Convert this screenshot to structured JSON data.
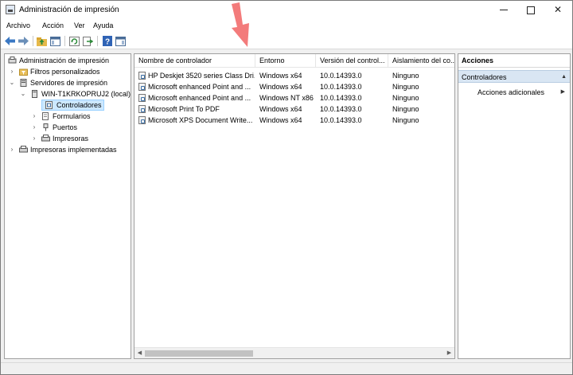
{
  "window": {
    "title": "Administración de impresión"
  },
  "menu": [
    "Archivo",
    "Acción",
    "Ver",
    "Ayuda"
  ],
  "toolbar": {
    "icons": [
      "back-icon",
      "forward-icon",
      "up-folder-icon",
      "show-hide-tree-icon",
      "refresh-icon",
      "export-list-icon",
      "help-icon",
      "show-hide-action-pane-icon"
    ]
  },
  "tree": {
    "root": "Administración de impresión",
    "custom_filters": "Filtros personalizados",
    "print_servers": "Servidores de impresión",
    "server": "WIN-T1KRKOPRUJ2 (local)",
    "drivers": "Controladores",
    "forms": "Formularios",
    "ports": "Puertos",
    "printers": "Impresoras",
    "deployed_printers": "Impresoras implementadas"
  },
  "table": {
    "columns": [
      "Nombre de controlador",
      "Entorno",
      "Versión del control...",
      "Aislamiento del co..."
    ],
    "rows": [
      [
        "HP Deskjet 3520 series Class Dri...",
        "Windows x64",
        "10.0.14393.0",
        "Ninguno"
      ],
      [
        "Microsoft enhanced Point and ...",
        "Windows x64",
        "10.0.14393.0",
        "Ninguno"
      ],
      [
        "Microsoft enhanced Point and ...",
        "Windows NT x86",
        "10.0.14393.0",
        "Ninguno"
      ],
      [
        "Microsoft Print To PDF",
        "Windows x64",
        "10.0.14393.0",
        "Ninguno"
      ],
      [
        "Microsoft XPS Document Write...",
        "Windows x64",
        "10.0.14393.0",
        "Ninguno"
      ]
    ]
  },
  "actions": {
    "header": "Acciones",
    "section": "Controladores",
    "more": "Acciones adicionales"
  },
  "colors": {
    "accent_arrow": "#f26d6d",
    "selection": "#cce8ff",
    "action_section": "#d9e6f3"
  }
}
